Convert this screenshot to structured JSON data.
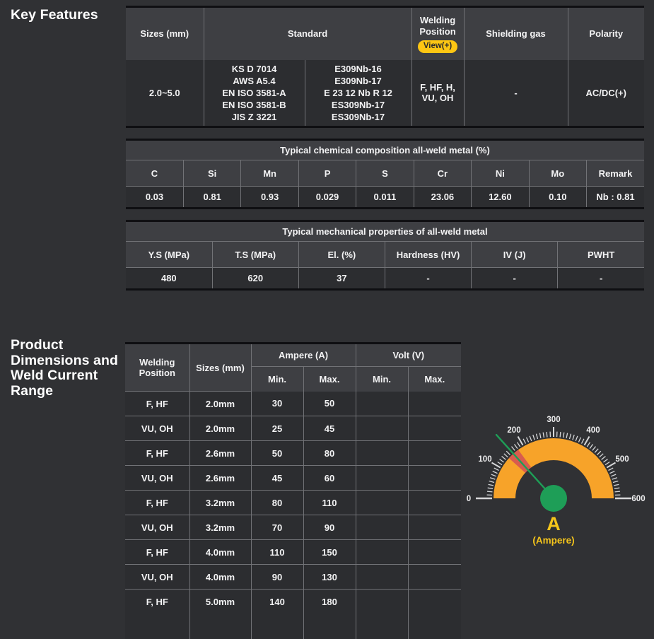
{
  "headings": {
    "key_features": "Key Features",
    "product_dimensions": "Product Dimensions and Weld Current Range"
  },
  "theme": {
    "background": "#303134",
    "header_cell": "#3e3f43",
    "data_cell": "#2c2d30",
    "cell_border": "#717276",
    "table_edge_border": "#0f0f12",
    "text": "#f3f3f4",
    "accent_yellow": "#fcc211",
    "badge_bg": "#fdc613",
    "badge_text": "#2b2b2b"
  },
  "key_features_table": {
    "headers": {
      "sizes": "Sizes (mm)",
      "standard": "Standard",
      "welding_position": "Welding Position",
      "view_badge": "View(+)",
      "shielding_gas": "Shielding gas",
      "polarity": "Polarity"
    },
    "row": {
      "sizes": "2.0~5.0",
      "standards_left": [
        "KS D 7014",
        "AWS A5.4",
        "EN ISO 3581-A",
        "EN ISO 3581-B",
        "JIS Z 3221"
      ],
      "standards_right": [
        "E309Nb-16",
        "E309Nb-17",
        "E 23 12 Nb R 12",
        "ES309Nb-17",
        "ES309Nb-17"
      ],
      "welding_position": "F, HF, H, VU, OH",
      "shielding_gas": "-",
      "polarity": "AC/DC(+)"
    }
  },
  "chemical_table": {
    "title": "Typical chemical composition all-weld metal (%)",
    "columns": [
      "C",
      "Si",
      "Mn",
      "P",
      "S",
      "Cr",
      "Ni",
      "Mo",
      "Remark"
    ],
    "values": [
      "0.03",
      "0.81",
      "0.93",
      "0.029",
      "0.011",
      "23.06",
      "12.60",
      "0.10",
      "Nb : 0.81"
    ]
  },
  "mechanical_table": {
    "title": "Typical mechanical properties of all-weld metal",
    "columns": [
      "Y.S (MPa)",
      "T.S (MPa)",
      "El. (%)",
      "Hardness (HV)",
      "IV (J)",
      "PWHT"
    ],
    "values": [
      "480",
      "620",
      "37",
      "-",
      "-",
      "-"
    ]
  },
  "current_table": {
    "headers": {
      "welding_position": "Welding Position",
      "sizes": "Sizes (mm)",
      "ampere": "Ampere (A)",
      "volt": "Volt (V)",
      "amp_min": "Min.",
      "amp_max": "Max.",
      "volt_min": "Min.",
      "volt_max": "Max."
    },
    "rows": [
      [
        "F, HF",
        "2.0mm",
        "30",
        "50",
        "",
        ""
      ],
      [
        "VU, OH",
        "2.0mm",
        "25",
        "45",
        "",
        ""
      ],
      [
        "F, HF",
        "2.6mm",
        "50",
        "80",
        "",
        ""
      ],
      [
        "VU, OH",
        "2.6mm",
        "45",
        "60",
        "",
        ""
      ],
      [
        "F, HF",
        "3.2mm",
        "80",
        "110",
        "",
        ""
      ],
      [
        "VU, OH",
        "3.2mm",
        "70",
        "90",
        "",
        ""
      ],
      [
        "F, HF",
        "4.0mm",
        "110",
        "150",
        "",
        ""
      ],
      [
        "VU, OH",
        "4.0mm",
        "90",
        "130",
        "",
        ""
      ],
      [
        "F, HF",
        "5.0mm",
        "140",
        "180",
        "",
        ""
      ]
    ]
  },
  "chart_data": {
    "type": "gauge",
    "title": "Ampere gauge",
    "min": 0,
    "max": 600,
    "major_tick_step": 100,
    "minor_tick_step": 10,
    "tick_labels": [
      "0",
      "100",
      "200",
      "300",
      "400",
      "500",
      "600"
    ],
    "highlight_range": [
      140,
      180
    ],
    "needle_value": 160,
    "unit_label": "A",
    "unit_sublabel": "(Ampere)",
    "colors": {
      "band": "#f7a329",
      "highlight": "#d85c4e",
      "needle": "#1e9e57",
      "hub": "#1e9e57",
      "tick": "#d6d7d9",
      "tick_label": "#ededee",
      "unit_text": "#f5c51b"
    }
  }
}
